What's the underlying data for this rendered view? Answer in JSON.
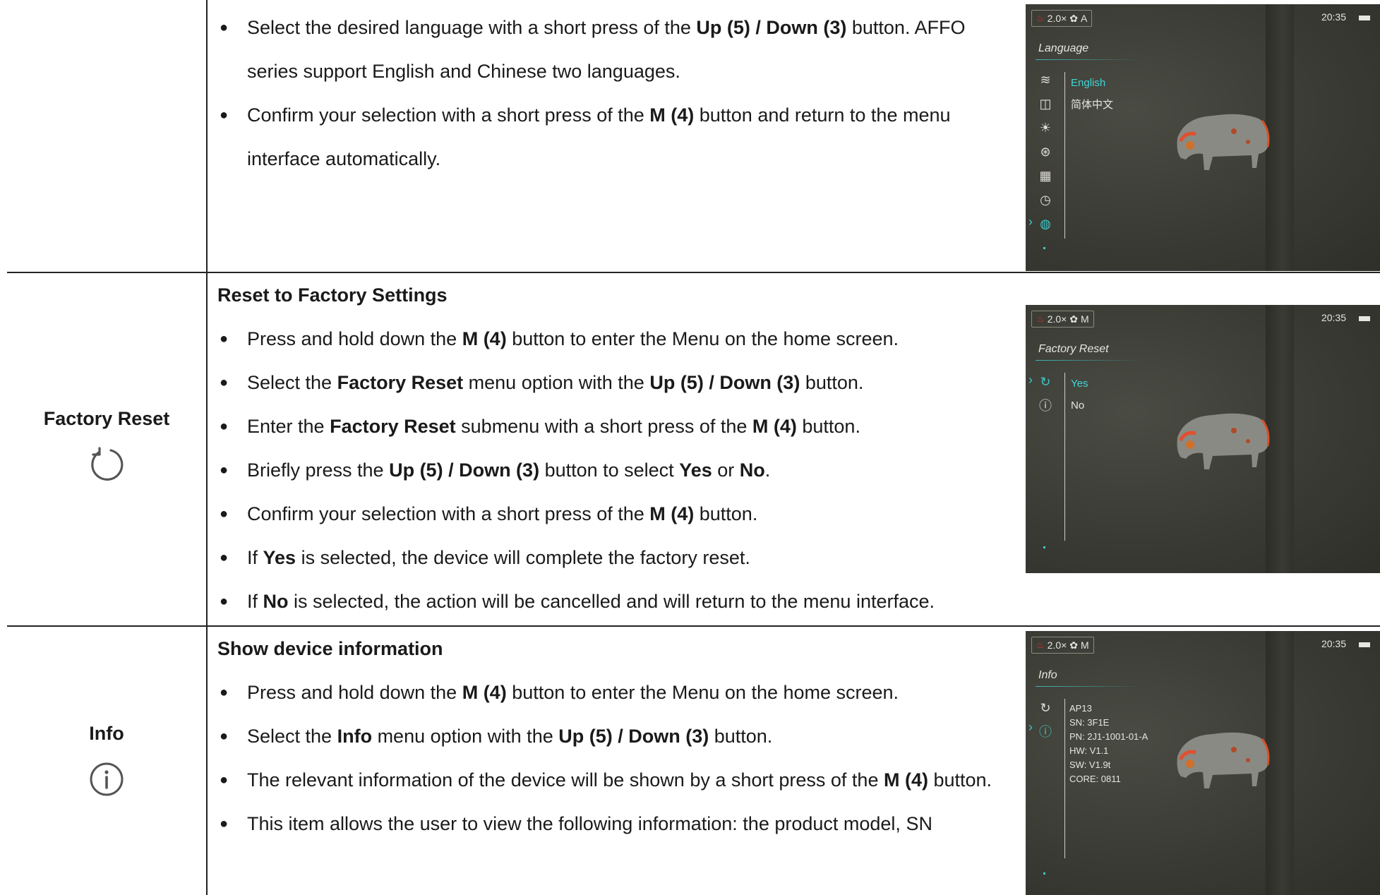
{
  "language_row": {
    "bullets": [
      [
        "Select the desired language with a short press of the ",
        {
          "b": "Up (5) / Down (3)"
        },
        " button. AFFO series support English and Chinese two languages."
      ],
      [
        "Confirm your selection with a short press of the ",
        {
          "b": "M (4)"
        },
        " button and return to the menu interface automatically."
      ]
    ],
    "screen": {
      "zoom": "2.0×",
      "mode": "A",
      "time": "20:35",
      "title": "Language",
      "options": [
        "English",
        "简体中文"
      ],
      "selected": 0,
      "icons": [
        "wifi-icon",
        "storage-icon",
        "brightness-icon",
        "palette-icon",
        "calendar-icon",
        "clock-icon",
        "globe-icon"
      ]
    }
  },
  "factory_row": {
    "label": "Factory Reset",
    "title": "Reset to Factory Settings",
    "bullets": [
      [
        "Press and hold down the ",
        {
          "b": "M (4)"
        },
        " button to enter the Menu on the home screen."
      ],
      [
        "Select the ",
        {
          "b": "Factory Reset"
        },
        " menu option with the ",
        {
          "b": "Up (5) / Down (3)"
        },
        " button."
      ],
      [
        "Enter the ",
        {
          "b": "Factory Reset"
        },
        " submenu with a short press of the ",
        {
          "b": "M (4)"
        },
        " button."
      ],
      [
        "Briefly press the ",
        {
          "b": "Up (5) / Down (3)"
        },
        " button to select ",
        {
          "b": "Yes"
        },
        " or ",
        {
          "b": "No"
        },
        "."
      ],
      [
        "Confirm your selection with a short press of the ",
        {
          "b": "M (4)"
        },
        " button."
      ],
      [
        "If ",
        {
          "b": "Yes"
        },
        " is selected, the device will complete the factory reset."
      ],
      [
        "If ",
        {
          "b": "No"
        },
        " is selected, the action will be cancelled and will return to the menu interface."
      ]
    ],
    "screen": {
      "zoom": "2.0×",
      "mode": "M",
      "time": "20:35",
      "title": "Factory Reset",
      "options": [
        "Yes",
        "No"
      ],
      "selected": 0,
      "icons": [
        "reset-icon",
        "info-icon"
      ]
    }
  },
  "info_row": {
    "label": "Info",
    "title": "Show device information",
    "bullets": [
      [
        " Press and hold down the ",
        {
          "b": "M (4)"
        },
        " button to enter the Menu on the home screen."
      ],
      [
        "Select the ",
        {
          "b": "Info"
        },
        " menu option with the ",
        {
          "b": "Up (5) / Down (3)"
        },
        " button."
      ],
      [
        "The relevant information of the device will be shown by a short press of the ",
        {
          "b": "M (4)"
        },
        " button."
      ],
      [
        "This item allows the user to view the following information: the product model, SN"
      ]
    ],
    "screen": {
      "zoom": "2.0×",
      "mode": "M",
      "time": "20:35",
      "title": "Info",
      "info_lines": [
        "AP13",
        "SN: 3F1E",
        "PN: 2J1-1001-01-A",
        "HW: V1.1",
        "SW: V1.9t",
        "CORE: 0811"
      ],
      "icons": [
        "reset-icon",
        "info-icon"
      ]
    }
  }
}
